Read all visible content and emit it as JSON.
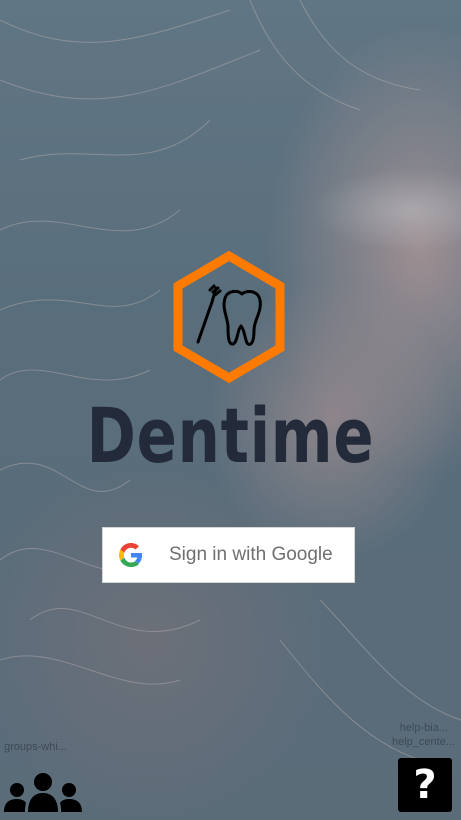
{
  "app": {
    "title": "Dentime"
  },
  "auth": {
    "google_button_label": "Sign in with Google"
  },
  "footer": {
    "groups_label": "groups-whi...",
    "help_label_line1": "help-bia...",
    "help_label_line2": "help_cente...",
    "help_button_glyph": "?"
  },
  "icons": {
    "logo": "hexagon-tooth-toothbrush-icon",
    "google": "google-g-icon",
    "groups": "groups-icon",
    "help": "question-mark-icon"
  },
  "colors": {
    "logo_hexagon": "#ff7a00",
    "title": "#232a3a",
    "google_blue": "#4285F4",
    "google_red": "#EA4335",
    "google_yellow": "#FBBC05",
    "google_green": "#34A853"
  }
}
